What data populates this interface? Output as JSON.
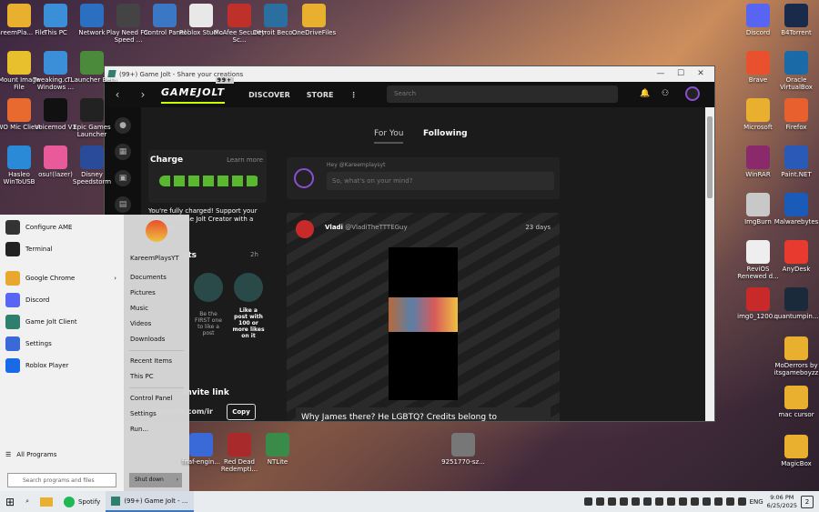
{
  "desktop_left": [
    {
      "label": "KareemPla... File",
      "color": "#e8b02e"
    },
    {
      "label": "This PC",
      "color": "#3a8fd8"
    },
    {
      "label": "Network",
      "color": "#2a6fc0"
    },
    {
      "label": "Play Need For Speed ...",
      "color": "#444"
    },
    {
      "label": "Control Panel",
      "color": "#3b78c4"
    },
    {
      "label": "Roblox Studio",
      "color": "#e8e8e8"
    },
    {
      "label": "McAfee Security Sc...",
      "color": "#c0302a"
    },
    {
      "label": "Detroit Beco...",
      "color": "#2a6fa0"
    },
    {
      "label": "OneDriveFiles",
      "color": "#e8b02e"
    },
    {
      "label": "Mount Image File",
      "color": "#e8c02e"
    },
    {
      "label": "Tweaking.c... - Windows ...",
      "color": "#3a8fd8"
    },
    {
      "label": "TLauncher Beta",
      "color": "#4a8a3a"
    },
    {
      "label": "WO Mic Client",
      "color": "#e86a2e"
    },
    {
      "label": "Voicemod V3",
      "color": "#111"
    },
    {
      "label": "Epic Games Launcher",
      "color": "#222"
    },
    {
      "label": "Hasleo WinToUSB",
      "color": "#2a8ad8"
    },
    {
      "label": "osu!(lazer)",
      "color": "#e85a9a"
    },
    {
      "label": "Disney Speedstorm",
      "color": "#2a4a9a"
    }
  ],
  "desktop_right": [
    {
      "label": "Discord",
      "color": "#5865f2"
    },
    {
      "label": "B4Torrent",
      "color": "#1a2a4a"
    },
    {
      "label": "Brave",
      "color": "#e8502e"
    },
    {
      "label": "Oracle VirtualBox",
      "color": "#1a6aa8"
    },
    {
      "label": "Microsoft",
      "color": "#e8b02e"
    },
    {
      "label": "Firefox",
      "color": "#e8602e"
    },
    {
      "label": "WinRAR",
      "color": "#8a2a6a"
    },
    {
      "label": "Paint.NET",
      "color": "#2a5ab8"
    },
    {
      "label": "ImgBurn",
      "color": "#c8c8c8"
    },
    {
      "label": "Malwarebytes",
      "color": "#1a5ab8"
    },
    {
      "label": "ReviOS Renewed d...",
      "color": "#eee"
    },
    {
      "label": "AnyDesk",
      "color": "#e83a2e"
    },
    {
      "label": "img0_1200...",
      "color": "#c82a2a"
    },
    {
      "label": "quantumpin...",
      "color": "#1a2a3a"
    },
    {
      "label": "MoDerrors by itsgameboyzz",
      "color": "#e8b02e"
    },
    {
      "label": "mac cursor",
      "color": "#e8b02e"
    },
    {
      "label": "MagicBox",
      "color": "#e8b02e"
    }
  ],
  "desktop_bottom": [
    {
      "label": "fnaf-engin...",
      "color": "#3a6ad8"
    },
    {
      "label": "Red Dead Redempti...",
      "color": "#a82a2a"
    },
    {
      "label": "NTLite",
      "color": "#3a8a4a"
    },
    {
      "label": "9251770-sz...",
      "color": "#777"
    }
  ],
  "window": {
    "title": "(99+) Game Jolt - Share your creations",
    "min": "—",
    "max": "☐",
    "close": "✕"
  },
  "nav": {
    "back": "‹",
    "forward": "›",
    "logo": "GAMEJOLT",
    "badge": "99+",
    "discover": "DISCOVER",
    "store": "STORE",
    "more": "⋮",
    "search_placeholder": "Search"
  },
  "charge": {
    "title": "Charge",
    "learn": "Learn more",
    "msg": "You're fully charged! Support your favorite Game Jolt Creator with a charged"
  },
  "quests": {
    "title": "sts",
    "time": "2h",
    "q1": "Be the FIRST one to like a post",
    "q2": "Like a post with 100 or more likes on it"
  },
  "invite": {
    "title": "Invite link",
    "url": "gamejolt.com/ir",
    "copy": "Copy"
  },
  "tabs": {
    "foryou": "For You",
    "following": "Following"
  },
  "composer": {
    "hey": "Hey @Kareemplaysyt",
    "placeholder": "So, what's on your mind?"
  },
  "post": {
    "user": "Vladi",
    "handle": "@VladiTheTTTEGuy",
    "age": "23 days",
    "caption": "Why James there? He LGBTQ? Credits belong to"
  },
  "start": {
    "left": [
      {
        "label": "Configure AME",
        "color": "#333"
      },
      {
        "label": "Terminal",
        "color": "#222"
      },
      {
        "label": "Google Chrome",
        "color": "#e8a82e",
        "arrow": "›"
      },
      {
        "label": "Discord",
        "color": "#5865f2"
      },
      {
        "label": "Game Jolt Client",
        "color": "#2f7f6f"
      },
      {
        "label": "Settings",
        "color": "#3a6ad8"
      },
      {
        "label": "Roblox Player",
        "color": "#1a6ae8"
      }
    ],
    "all": "All Programs",
    "search": "Search programs and files",
    "right": [
      "KareemPlaysYT",
      "Documents",
      "Pictures",
      "Music",
      "Videos",
      "Downloads",
      "Recent Items",
      "This PC",
      "Control Panel",
      "Settings",
      "Run..."
    ],
    "shutdown": "Shut down"
  },
  "taskbar": {
    "spotify": "Spotify",
    "gamejolt": "(99+) Game Jolt - ...",
    "lang": "ENG",
    "time": "9:06 PM",
    "date": "6/25/2025",
    "notif": "2"
  }
}
